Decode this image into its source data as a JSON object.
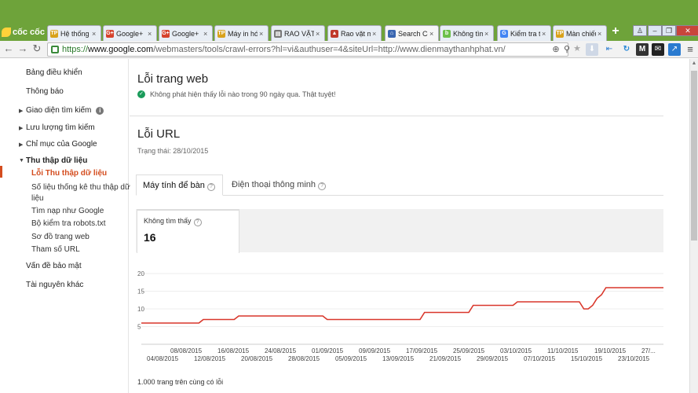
{
  "browser": {
    "logo_text": "cốc cốc",
    "tabs": [
      {
        "title": "Hệ thống điện",
        "favicon_text": "TP",
        "favicon_color": "#d9a21b"
      },
      {
        "title": "Google+",
        "favicon_text": "G+",
        "favicon_color": "#d6422c"
      },
      {
        "title": "Google+",
        "favicon_text": "G+",
        "favicon_color": "#d6422c"
      },
      {
        "title": "Máy in hóa đơn",
        "favicon_text": "TP",
        "favicon_color": "#d9a21b"
      },
      {
        "title": "RAO VẶT S",
        "favicon_text": "▤",
        "favicon_color": "#777777"
      },
      {
        "title": "Rao vặt miễn phí",
        "favicon_text": "▲",
        "favicon_color": "#c0392b"
      },
      {
        "title": "Search Console",
        "favicon_text": "⌂",
        "favicon_color": "#3a66b0"
      },
      {
        "title": "Không tìm thấy",
        "favicon_text": "b",
        "favicon_color": "#6cc04a"
      },
      {
        "title": "Kiểm tra tốc độ",
        "favicon_text": "G",
        "favicon_color": "#4285f4"
      },
      {
        "title": "Màn chiếu",
        "favicon_text": "TP",
        "favicon_color": "#d9a21b"
      }
    ],
    "new_tab_label": "+",
    "url_scheme": "https://",
    "url_domain": "www.google.com",
    "url_path": "/webmasters/tools/crawl-errors?hl=vi&authuser=4&siteUrl=http://www.dienmaythanhphat.vn/"
  },
  "sidebar": {
    "items": [
      {
        "label": "Bảng điều khiển"
      },
      {
        "label": "Thông báo"
      },
      {
        "label": "Giao diện tìm kiếm"
      },
      {
        "label": "Lưu lượng tìm kiếm"
      },
      {
        "label": "Chỉ mục của Google"
      },
      {
        "label": "Thu thập dữ liệu"
      },
      {
        "label": "Lỗi Thu thập dữ liệu"
      },
      {
        "label": "Số liệu thống kê thu thập dữ"
      },
      {
        "label": "liệu"
      },
      {
        "label": "Tìm nạp như Google"
      },
      {
        "label": "Bộ kiểm tra robots.txt"
      },
      {
        "label": "Sơ đồ trang web"
      },
      {
        "label": "Tham số URL"
      },
      {
        "label": "Vấn đề bảo mật"
      },
      {
        "label": "Tài nguyên khác"
      }
    ]
  },
  "main": {
    "site_errors_title": "Lỗi trang web",
    "site_errors_message": "Không phát hiện thấy lỗi nào trong 90 ngày qua. Thật tuyệt!",
    "url_errors_title": "Lỗi URL",
    "status_text": "Trạng thái: 28/10/2015",
    "tabs": [
      {
        "label": "Máy tính để bàn"
      },
      {
        "label": "Điện thoại thông minh"
      }
    ],
    "metric_label": "Không tìm thấy",
    "metric_value": "16",
    "footer_text": "1.000 trang trên cùng có lỗi"
  },
  "chart_data": {
    "type": "line",
    "series": [
      {
        "values": [
          6,
          6,
          6,
          6,
          6,
          6,
          6,
          6,
          6,
          6,
          6,
          6,
          6,
          6,
          7,
          7,
          7,
          7,
          7,
          7,
          7,
          7,
          8,
          8,
          8,
          8,
          8,
          8,
          8,
          8,
          8,
          8,
          8,
          8,
          8,
          8,
          8,
          8,
          8,
          8,
          8,
          8,
          7,
          7,
          7,
          7,
          7,
          7,
          7,
          7,
          7,
          7,
          7,
          7,
          7,
          7,
          7,
          7,
          7,
          7,
          7,
          7,
          7,
          7,
          9,
          9,
          9,
          9,
          9,
          9,
          9,
          9,
          9,
          9,
          9,
          11,
          11,
          11,
          11,
          11,
          11,
          11,
          11,
          11,
          11,
          12,
          12,
          12,
          12,
          12,
          12,
          12,
          12,
          12,
          12,
          12,
          12,
          12,
          12,
          12,
          10,
          10,
          11,
          13,
          14,
          16,
          16,
          16,
          16,
          16,
          16,
          16,
          16,
          16,
          16,
          16,
          16,
          16,
          16
        ]
      }
    ],
    "y_ticks": [
      "20",
      "15",
      "10",
      "5"
    ],
    "ylim": [
      0,
      20
    ],
    "x_ticks_top": [
      "08/08/2015",
      "16/08/2015",
      "24/08/2015",
      "01/09/2015",
      "09/09/2015",
      "17/09/2015",
      "25/09/2015",
      "03/10/2015",
      "11/10/2015",
      "19/10/2015",
      "27/..."
    ],
    "x_ticks_bottom": [
      "04/08/2015",
      "12/08/2015",
      "20/08/2015",
      "28/08/2015",
      "05/09/2015",
      "13/09/2015",
      "21/09/2015",
      "29/09/2015",
      "07/10/2015",
      "15/10/2015",
      "23/10/2015"
    ],
    "line_color": "#d9372b",
    "grid": true
  }
}
